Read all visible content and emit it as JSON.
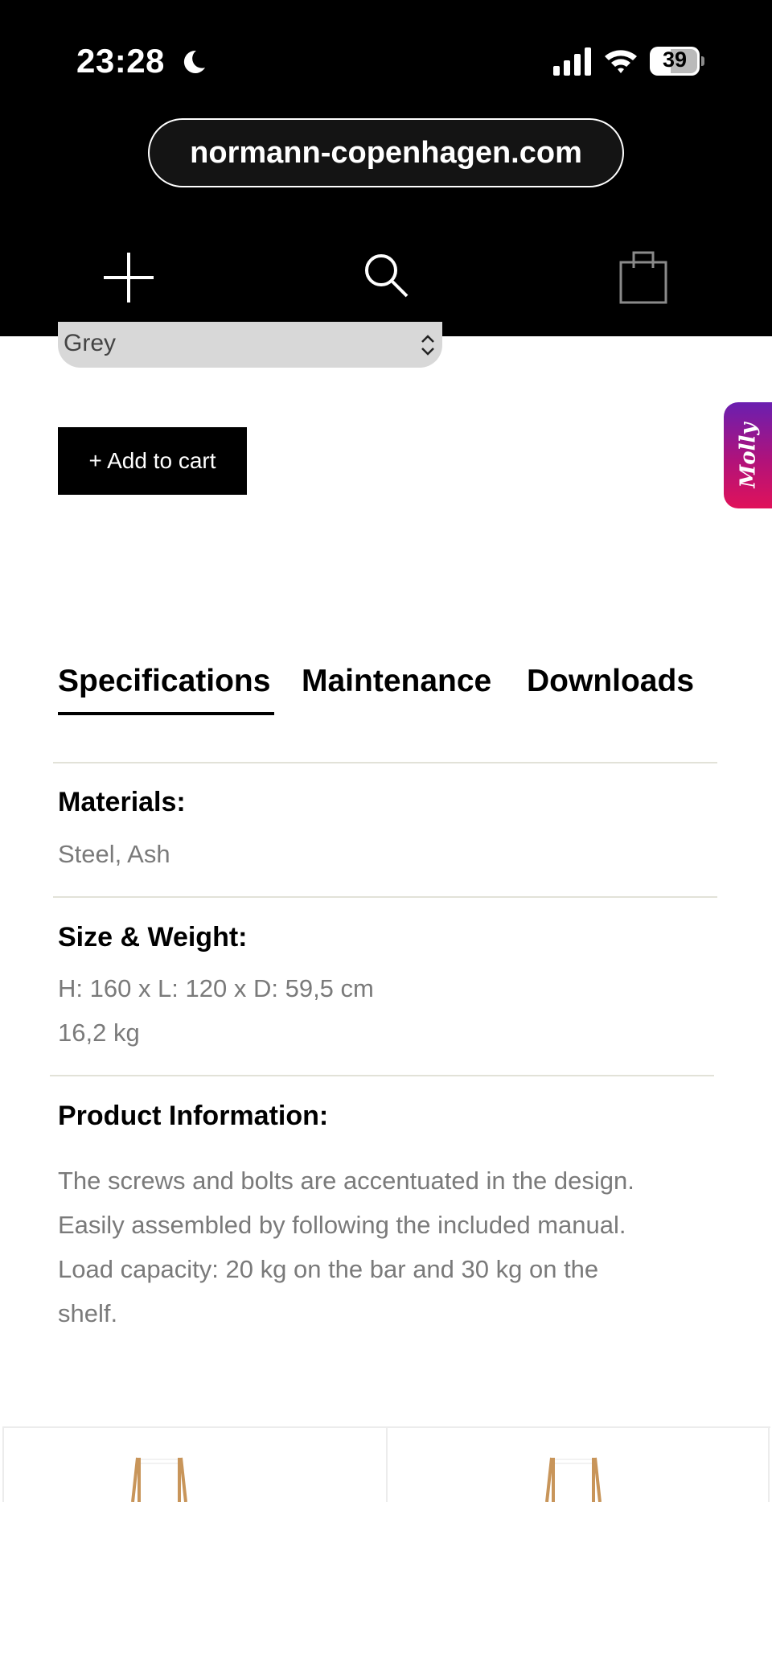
{
  "status_bar": {
    "time": "23:28",
    "battery": "39"
  },
  "browser": {
    "url": "normann-copenhagen.com"
  },
  "product": {
    "color_select_value": "Grey",
    "add_to_cart_label": "+ Add to cart"
  },
  "chat_widget": {
    "label": "Molly"
  },
  "tabs": [
    {
      "label": "Specifications",
      "active": true
    },
    {
      "label": "Maintenance",
      "active": false
    },
    {
      "label": "Downloads",
      "active": false
    }
  ],
  "specifications": {
    "materials_label": "Materials:",
    "materials_value": "Steel, Ash",
    "size_label": "Size & Weight:",
    "size_line1": "H: 160 x L: 120 x D: 59,5 cm",
    "size_line2": "16,2 kg",
    "info_label": "Product Information:",
    "info_line1": "The screws and bolts are accentuated in the design.",
    "info_line2": "Easily assembled by following the included manual.",
    "info_line3": "Load capacity: 20 kg on the bar and 30 kg on the",
    "info_line4": "shelf."
  },
  "colors": {
    "chrome_bg": "#000000",
    "select_bg": "#d8d8d8",
    "muted_text": "#7a7a7a",
    "divider": "#e2e2d8",
    "molly_gradient_start": "#6a1fb0",
    "molly_gradient_end": "#e0125a",
    "wood": "#c8955a"
  }
}
